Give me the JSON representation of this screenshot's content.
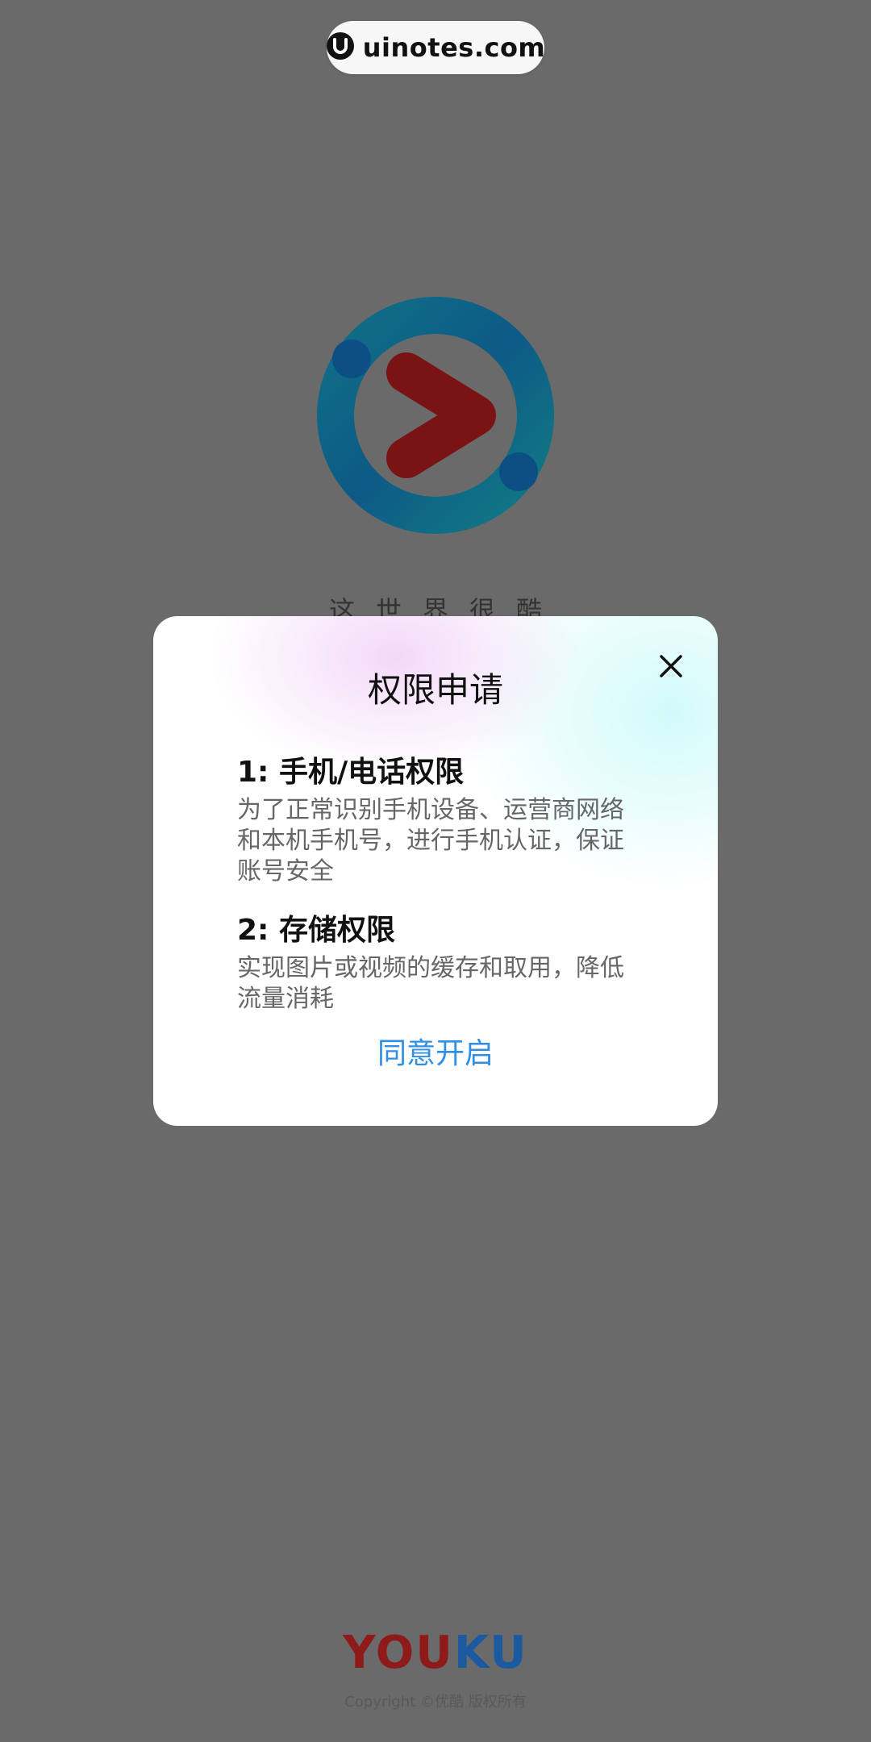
{
  "watermark": {
    "text": "uinotes.com"
  },
  "splash": {
    "slogan": "这世界很酷",
    "brand_part1": "YOU",
    "brand_part2": "KU",
    "copyright": "Copyright ©优酷 版权所有"
  },
  "dialog": {
    "title": "权限申请",
    "close_icon": "close-icon",
    "permissions": [
      {
        "title": "1: 手机/电话权限",
        "description": "为了正常识别手机设备、运营商网络和本机手机号，进行手机认证，保证账号安全"
      },
      {
        "title": "2: 存储权限",
        "description": "实现图片或视频的缓存和取用，降低流量消耗"
      }
    ],
    "agree_label": "同意开启"
  },
  "colors": {
    "overlay": "#6a6a6a",
    "accent": "#2e8fe6",
    "brand_red": "#8e1a1a",
    "brand_blue": "#1c5aa0"
  }
}
